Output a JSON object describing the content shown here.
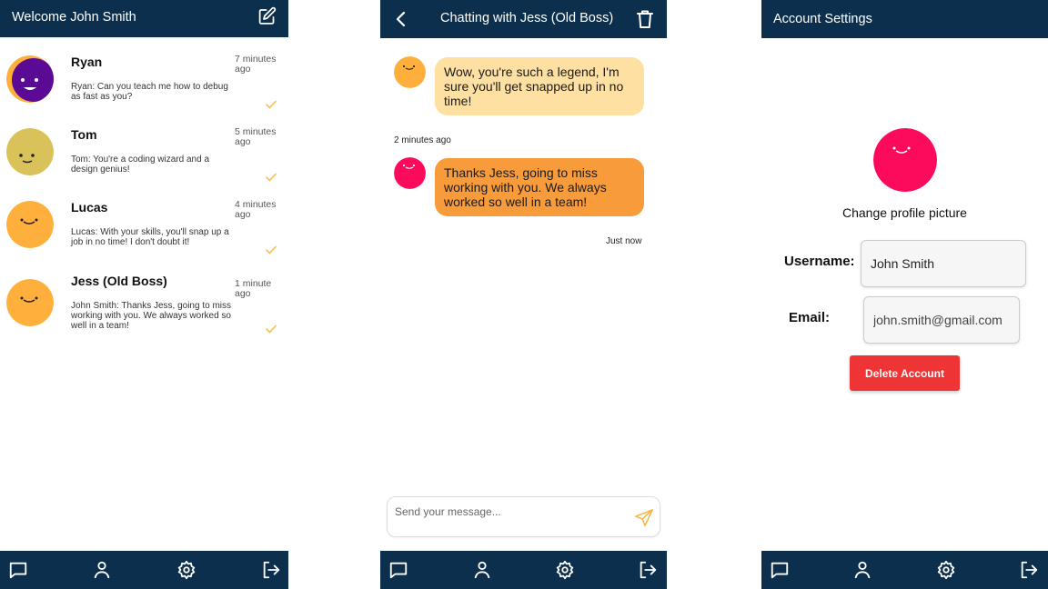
{
  "colors": {
    "navy": "#0c2f4d",
    "accent_orange": "#f89c3b",
    "received_bubble": "#ffe0a3",
    "tick_yellow": "#f6c04a",
    "delete_red": "#ee3434",
    "avatar_purple": "#5b0a96",
    "avatar_olive": "#dac25a",
    "avatar_orange": "#ffaf3b",
    "avatar_pink": "#fc0a5c"
  },
  "conversations_screen": {
    "title": "Welcome John Smith",
    "compose_icon": "edit-icon",
    "items": [
      {
        "name": "Ryan",
        "time": "7 minutes ago",
        "preview": "Ryan: Can you teach me how to debug as fast as you?",
        "avatar_color": "#5b0a96",
        "read_icon": "check-icon"
      },
      {
        "name": "Tom",
        "time": "5 minutes ago",
        "preview": "Tom: You're a coding wizard and a design genius!",
        "avatar_color": "#dac25a",
        "read_icon": "check-icon"
      },
      {
        "name": "Lucas",
        "time": "4 minutes ago",
        "preview": "Lucas: With your skills, you'll snap up a job in no time! I don't doubt it!",
        "avatar_color": "#ffaf3b",
        "read_icon": "check-icon"
      },
      {
        "name": "Jess (Old Boss)",
        "time": "1 minute ago",
        "preview": "John Smith: Thanks Jess, going to miss working with you. We always worked so well in a team!",
        "avatar_color": "#ffaf3b",
        "read_icon": "check-icon"
      }
    ]
  },
  "chat_screen": {
    "title": "Chatting with Jess (Old Boss)",
    "back_icon": "chevron-left-icon",
    "delete_icon": "trash-icon",
    "messages": [
      {
        "direction": "received",
        "text": "Wow, you're such a legend, I'm sure you'll get snapped up in no time!",
        "timestamp": "2 minutes ago"
      },
      {
        "direction": "sent",
        "text": "Thanks Jess, going to miss working with you. We always worked so well in a team!",
        "timestamp": "Just now"
      }
    ],
    "composer": {
      "placeholder": "Send your message...",
      "send_icon": "send-icon"
    }
  },
  "settings_screen": {
    "title": "Account Settings",
    "change_picture_label": "Change profile picture",
    "username_label": "Username:",
    "username_value": "John Smith",
    "email_label": "Email:",
    "email_value": "john.smith@gmail.com",
    "delete_button": "Delete Account"
  },
  "bottom_nav": [
    {
      "id": "chats",
      "icon": "chat-bubble-icon"
    },
    {
      "id": "profile",
      "icon": "user-icon"
    },
    {
      "id": "settings",
      "icon": "gear-icon"
    },
    {
      "id": "logout",
      "icon": "logout-icon"
    }
  ]
}
